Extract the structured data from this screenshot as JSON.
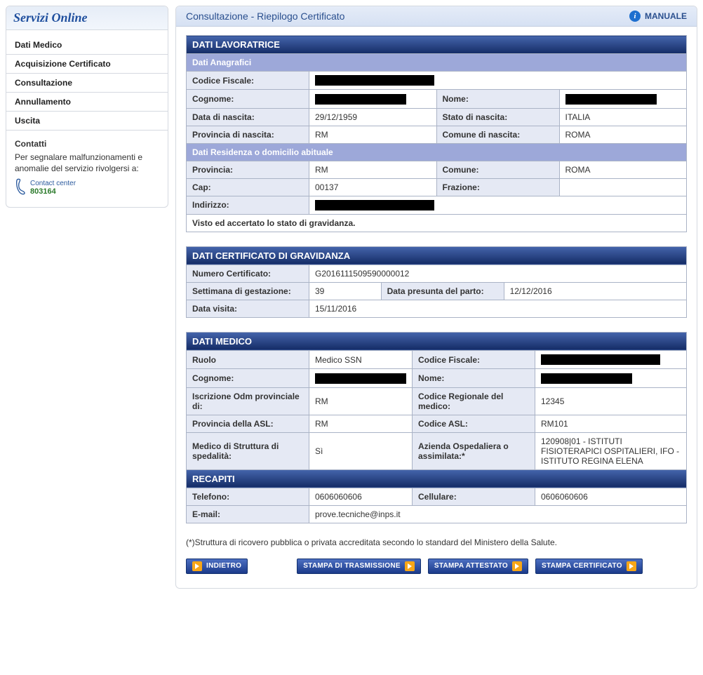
{
  "sidebar": {
    "title": "Servizi Online",
    "items": [
      {
        "label": "Dati Medico"
      },
      {
        "label": "Acquisizione Certificato"
      },
      {
        "label": "Consultazione"
      },
      {
        "label": "Annullamento"
      },
      {
        "label": "Uscita"
      }
    ],
    "contacts": {
      "title": "Contatti",
      "text": "Per segnalare malfunzionamenti e anomalie del servizio rivolgersi a:",
      "label": "Contact center",
      "phone": "803164"
    }
  },
  "header": {
    "title": "Consultazione - Riepilogo Certificato",
    "manuale": "MANUALE"
  },
  "worker": {
    "section": "DATI LAVORATRICE",
    "anag_section": "Dati Anagrafici",
    "cf_lbl": "Codice Fiscale:",
    "cf_val": "",
    "cognome_lbl": "Cognome:",
    "cognome_val": "",
    "nome_lbl": "Nome:",
    "nome_val": "",
    "dob_lbl": "Data di nascita:",
    "dob_val": "29/12/1959",
    "stato_lbl": "Stato di nascita:",
    "stato_val": "ITALIA",
    "prov_nasc_lbl": "Provincia di nascita:",
    "prov_nasc_val": "RM",
    "comune_nasc_lbl": "Comune di nascita:",
    "comune_nasc_val": "ROMA",
    "resid_section": "Dati Residenza o domicilio abituale",
    "prov_lbl": "Provincia:",
    "prov_val": "RM",
    "comune_lbl": "Comune:",
    "comune_val": "ROMA",
    "cap_lbl": "Cap:",
    "cap_val": "00137",
    "fraz_lbl": "Frazione:",
    "fraz_val": "",
    "ind_lbl": "Indirizzo:",
    "ind_val": "",
    "statement": "Visto ed accertato lo stato di gravidanza."
  },
  "cert": {
    "section": "DATI CERTIFICATO DI GRAVIDANZA",
    "num_lbl": "Numero Certificato:",
    "num_val": "G2016111509590000012",
    "sett_lbl": "Settimana di gestazione:",
    "sett_val": "39",
    "dpp_lbl": "Data presunta del parto:",
    "dpp_val": "12/12/2016",
    "visita_lbl": "Data visita:",
    "visita_val": "15/11/2016"
  },
  "medico": {
    "section": "DATI MEDICO",
    "ruolo_lbl": "Ruolo",
    "ruolo_val": "Medico SSN",
    "cf_lbl": "Codice Fiscale:",
    "cf_val": "",
    "cognome_lbl": "Cognome:",
    "cognome_val": "",
    "nome_lbl": "Nome:",
    "nome_val": "",
    "odm_lbl": "Iscrizione Odm provinciale di:",
    "odm_val": "RM",
    "codreg_lbl": "Codice Regionale del medico:",
    "codreg_val": "12345",
    "asl_prov_lbl": "Provincia della ASL:",
    "asl_prov_val": "RM",
    "asl_cod_lbl": "Codice ASL:",
    "asl_cod_val": "RM101",
    "struttura_lbl": "Medico di Struttura di spedalità:",
    "struttura_val": "Sì",
    "azienda_lbl": "Azienda Ospedaliera o assimilata:*",
    "azienda_val": "120908|01 - ISTITUTI FISIOTERAPICI OSPITALIERI, IFO - ISTITUTO REGINA ELENA"
  },
  "recapiti": {
    "section": "RECAPITI",
    "tel_lbl": "Telefono:",
    "tel_val": "0606060606",
    "cell_lbl": "Cellulare:",
    "cell_val": "0606060606",
    "email_lbl": "E-mail:",
    "email_val": "prove.tecniche@inps.it"
  },
  "footnote": "(*)Struttura di ricovero pubblica o privata accreditata secondo lo standard del Ministero della Salute.",
  "buttons": {
    "back": "INDIETRO",
    "transmit": "STAMPA DI TRASMISSIONE",
    "attestato": "STAMPA ATTESTATO",
    "certificato": "STAMPA CERTIFICATO"
  }
}
